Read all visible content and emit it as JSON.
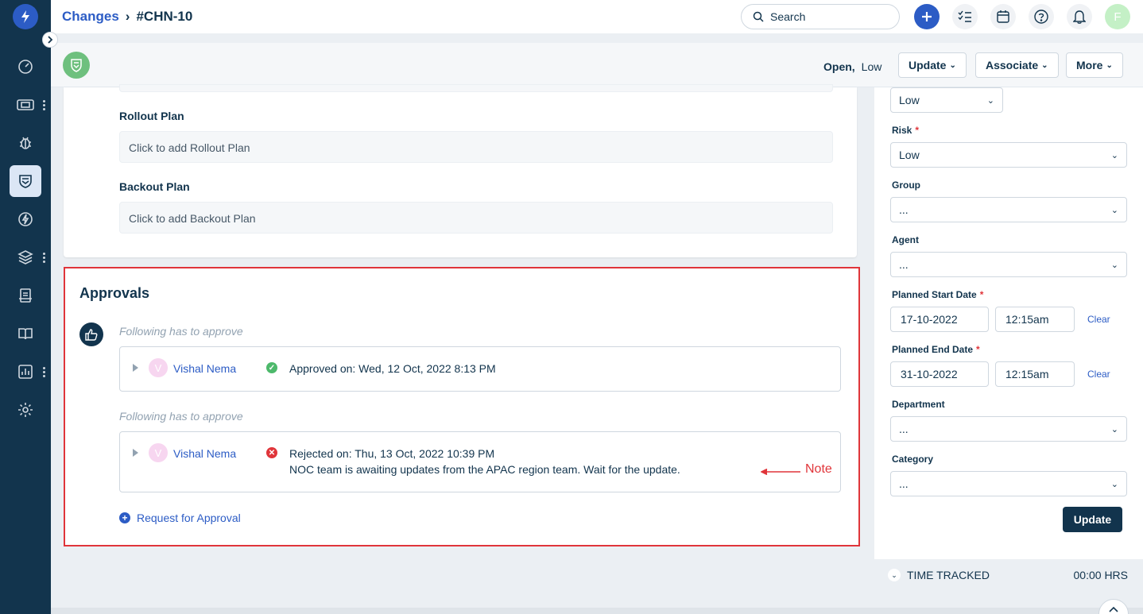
{
  "breadcrumb": {
    "parent": "Changes",
    "separator": "›",
    "current": "#CHN-10"
  },
  "search": {
    "placeholder": "Search"
  },
  "user_avatar": "F",
  "status": {
    "state": "Open,",
    "priority": "Low"
  },
  "header_buttons": {
    "update": "Update",
    "associate": "Associate",
    "more": "More"
  },
  "fields": {
    "rollout_plan": {
      "label": "Rollout Plan",
      "placeholder": "Click to add Rollout Plan"
    },
    "backout_plan": {
      "label": "Backout Plan",
      "placeholder": "Click to add Backout Plan"
    }
  },
  "approvals": {
    "title": "Approvals",
    "groups": [
      {
        "subtitle": "Following has to approve",
        "approver_initial": "V",
        "approver": "Vishal Nema",
        "status": "approved",
        "text": "Approved on: Wed, 12 Oct, 2022 8:13 PM",
        "note": ""
      },
      {
        "subtitle": "Following has to approve",
        "approver_initial": "V",
        "approver": "Vishal Nema",
        "status": "rejected",
        "text": "Rejected on: Thu, 13 Oct, 2022 10:39 PM",
        "note": "NOC team is awaiting updates from the APAC region team. Wait for the update."
      }
    ],
    "annotation": "Note",
    "request_link": "Request for Approval"
  },
  "properties": {
    "impact_value": "Low",
    "risk": {
      "label": "Risk",
      "value": "Low"
    },
    "group": {
      "label": "Group",
      "value": "..."
    },
    "agent": {
      "label": "Agent",
      "value": "..."
    },
    "planned_start": {
      "label": "Planned Start Date",
      "date": "17-10-2022",
      "time": "12:15am",
      "clear": "Clear"
    },
    "planned_end": {
      "label": "Planned End Date",
      "date": "31-10-2022",
      "time": "12:15am",
      "clear": "Clear"
    },
    "department": {
      "label": "Department",
      "value": "..."
    },
    "category": {
      "label": "Category",
      "value": "..."
    },
    "required_marker": "*",
    "update_button": "Update"
  },
  "time_tracked": {
    "label": "TIME TRACKED",
    "value": "00:00 HRS"
  },
  "colors": {
    "navy": "#12344d",
    "link": "#2c5cc5",
    "approved": "#4db96b",
    "rejected": "#e0353a",
    "annotation": "#e0353a"
  }
}
